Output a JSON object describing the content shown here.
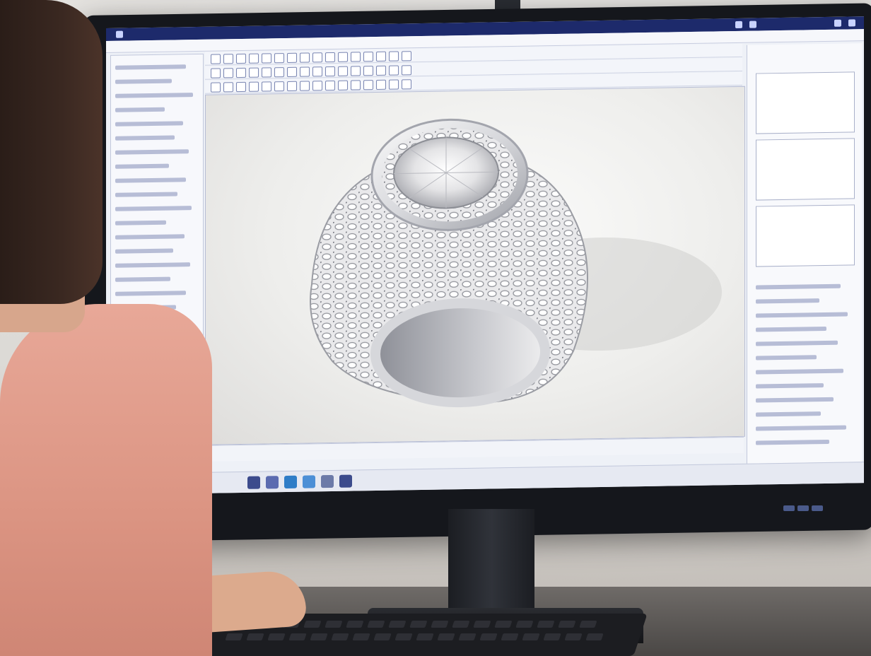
{
  "scene": {
    "subject": "ring",
    "colors": {
      "shirt": "#db9482",
      "hair": "#3a2821",
      "skin": "#dcaa8d",
      "monitor_bezel": "#15171c",
      "app_titlebar": "#1d2a6b",
      "preview_highlight": "#7fd858"
    }
  },
  "icons": [
    "app-icon",
    "toolbar-icon",
    "thumbnail-icon",
    "taskbar-icon"
  ]
}
